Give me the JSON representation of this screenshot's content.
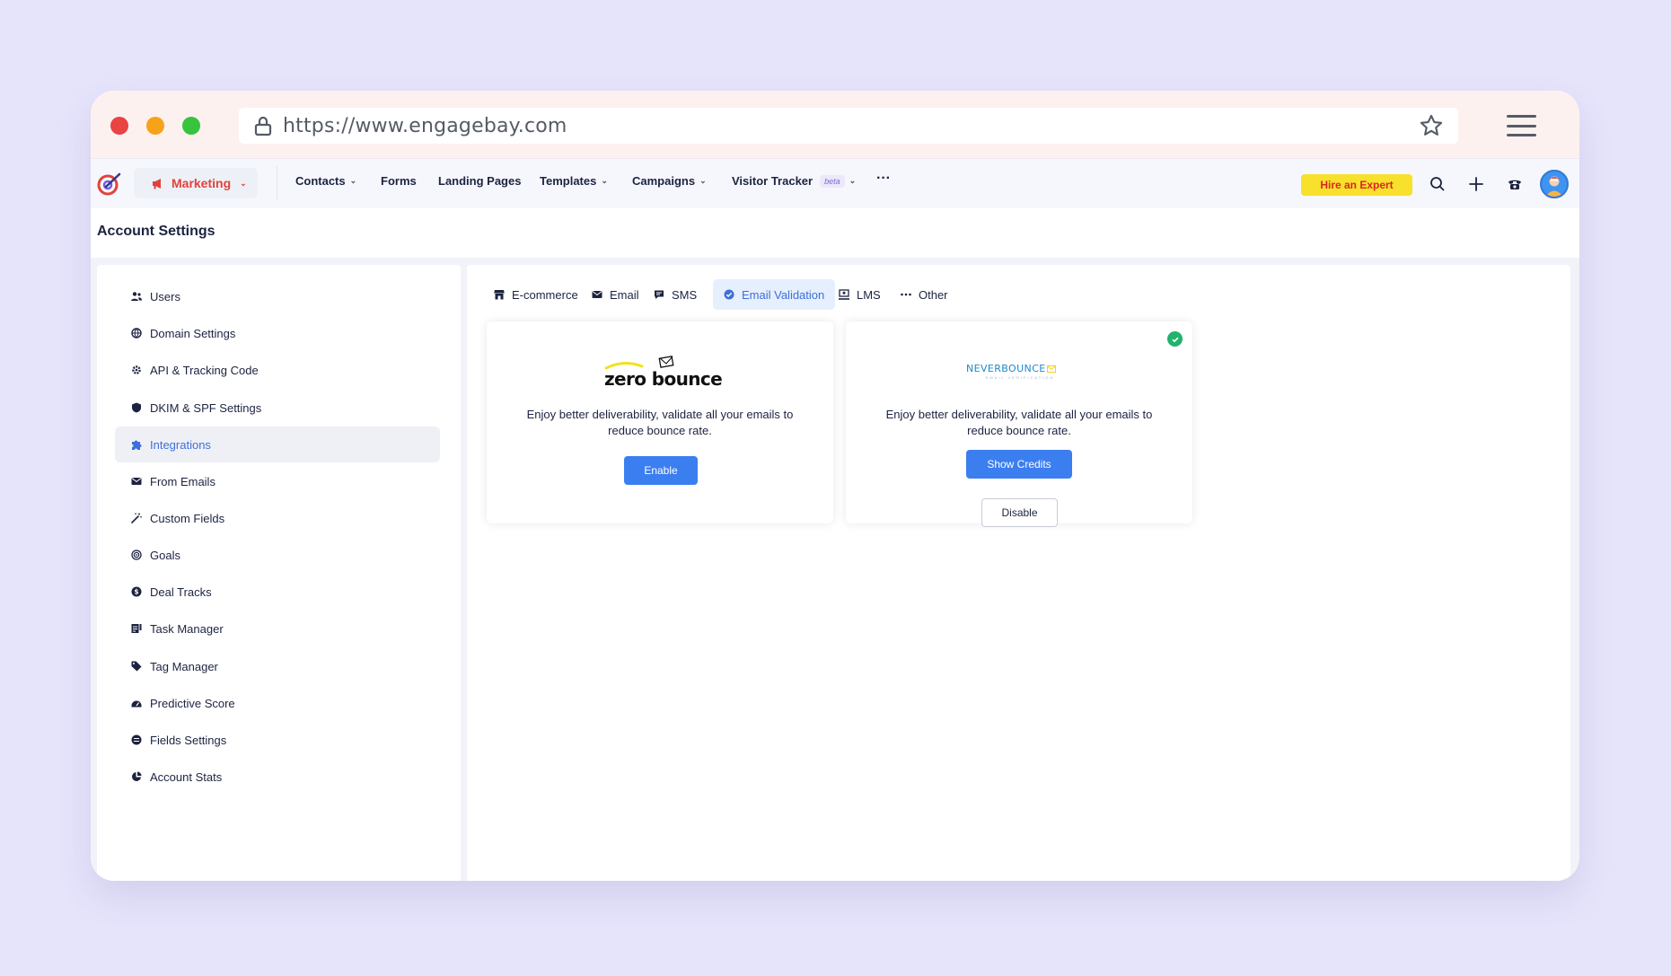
{
  "browser": {
    "url": "https://www.engagebay.com"
  },
  "nav": {
    "module": "Marketing",
    "items": [
      {
        "label": "Contacts"
      },
      {
        "label": "Forms"
      },
      {
        "label": "Landing Pages"
      },
      {
        "label": "Templates"
      },
      {
        "label": "Campaigns"
      },
      {
        "label": "Visitor Tracker"
      }
    ],
    "beta_label": "beta",
    "more": "···",
    "hire_expert": "Hire an Expert"
  },
  "page": {
    "title": "Account Settings"
  },
  "sidebar": {
    "items": [
      {
        "label": "Users",
        "icon": "users-icon"
      },
      {
        "label": "Domain Settings",
        "icon": "globe-icon"
      },
      {
        "label": "API & Tracking Code",
        "icon": "gear-icon"
      },
      {
        "label": "DKIM & SPF Settings",
        "icon": "shield-icon"
      },
      {
        "label": "Integrations",
        "icon": "puzzle-icon"
      },
      {
        "label": "From Emails",
        "icon": "envelope-icon"
      },
      {
        "label": "Custom Fields",
        "icon": "magic-wand-icon"
      },
      {
        "label": "Goals",
        "icon": "target-icon"
      },
      {
        "label": "Deal Tracks",
        "icon": "dollar-icon"
      },
      {
        "label": "Task Manager",
        "icon": "tasks-icon"
      },
      {
        "label": "Tag Manager",
        "icon": "tag-icon"
      },
      {
        "label": "Predictive Score",
        "icon": "gauge-icon"
      },
      {
        "label": "Fields Settings",
        "icon": "fields-icon"
      },
      {
        "label": "Account Stats",
        "icon": "pie-chart-icon"
      }
    ],
    "active_index": 4
  },
  "tabs": {
    "items": [
      {
        "label": "E-commerce",
        "icon": "store-icon"
      },
      {
        "label": "Email",
        "icon": "envelope-icon"
      },
      {
        "label": "SMS",
        "icon": "message-icon"
      },
      {
        "label": "Email Validation",
        "icon": "check-circle-icon"
      },
      {
        "label": "LMS",
        "icon": "lms-icon"
      },
      {
        "label": "Other",
        "icon": "ellipsis-icon"
      }
    ],
    "active_index": 3
  },
  "cards": [
    {
      "logo_text": "zero bounce",
      "description": "Enjoy better deliverability, validate all your emails to reduce bounce rate.",
      "primary_button": "Enable"
    },
    {
      "logo_text": "NEVERBOUNCE",
      "logo_sub": "EMAIL VERIFICATION",
      "description": "Enjoy better deliverability, validate all your emails to reduce bounce rate.",
      "primary_button": "Show Credits",
      "secondary_button": "Disable",
      "connected": true
    }
  ],
  "colors": {
    "accent": "#3b7ef0",
    "brand_red": "#e2423a",
    "hire_bg": "#f8e12c",
    "success": "#23b26d"
  }
}
